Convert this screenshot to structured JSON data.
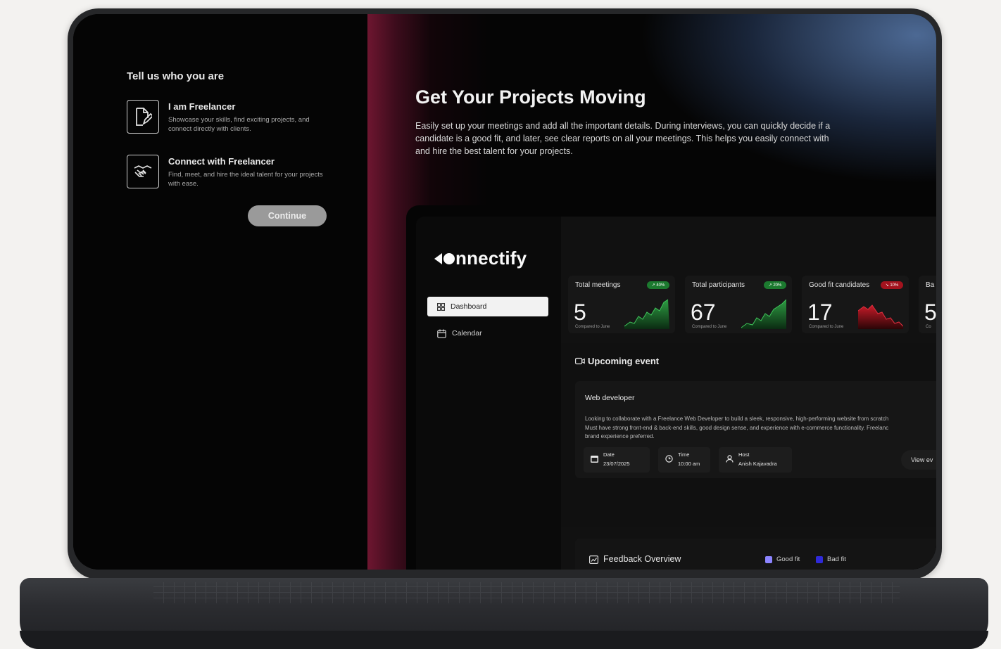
{
  "onboarding": {
    "heading": "Tell us who you are",
    "options": [
      {
        "title": "I am Freelancer",
        "desc": "Showcase your skills, find exciting projects, and connect directly with clients.",
        "icon": "document-edit-icon"
      },
      {
        "title": "Connect with Freelancer",
        "desc": "Find, meet, and hire the ideal talent for your projects with ease.",
        "icon": "handshake-icon"
      }
    ],
    "continue_label": "Continue"
  },
  "hero": {
    "title": "Get Your Projects Moving",
    "text": "Easily set up your meetings and add all the important details. During interviews, you can quickly decide if a candidate is a good fit, and later, see clear reports on all your meetings. This helps you easily connect with and hire the best talent for your projects."
  },
  "app": {
    "brand": "nnectify",
    "nav": [
      {
        "label": "Dashboard",
        "icon": "dashboard-grid-icon",
        "active": true
      },
      {
        "label": "Calendar",
        "icon": "calendar-icon",
        "active": false
      }
    ],
    "stats": [
      {
        "label": "Total meetings",
        "value": "5",
        "badge": "↗ 40%",
        "trend": "up",
        "compare": "Compared to June"
      },
      {
        "label": "Total participants",
        "value": "67",
        "badge": "↗ 20%",
        "trend": "up",
        "compare": "Compared to June"
      },
      {
        "label": "Good fit candidates",
        "value": "17",
        "badge": "↘ 10%",
        "trend": "down",
        "compare": "Compared to June"
      },
      {
        "label": "Ba",
        "value": "5",
        "badge": "",
        "trend": "up",
        "compare": "Co"
      }
    ],
    "upcoming": {
      "title": "Upcoming event",
      "event": {
        "title": "Web developer",
        "desc_lines": [
          "Looking to collaborate with a Freelance Web Developer to build a sleek, responsive, high-performing website from scratch",
          "Must have strong front-end & back-end skills, good design sense, and experience with e-commerce functionality. Freelanc",
          "brand experience preferred."
        ],
        "date_label": "Date",
        "date_value": "23/07/2025",
        "time_label": "Time",
        "time_value": "10:00 am",
        "host_label": "Host",
        "host_value": "Anish Kajavadra",
        "view_label": "View ev"
      }
    },
    "feedback": {
      "title": "Feedback Overview",
      "legend_good": "Good fit",
      "legend_bad": "Bad fit",
      "color_good": "#8c84ff",
      "color_bad": "#2f2ad9"
    },
    "colors": {
      "up": "#2e9d43",
      "down": "#c81b29"
    }
  }
}
